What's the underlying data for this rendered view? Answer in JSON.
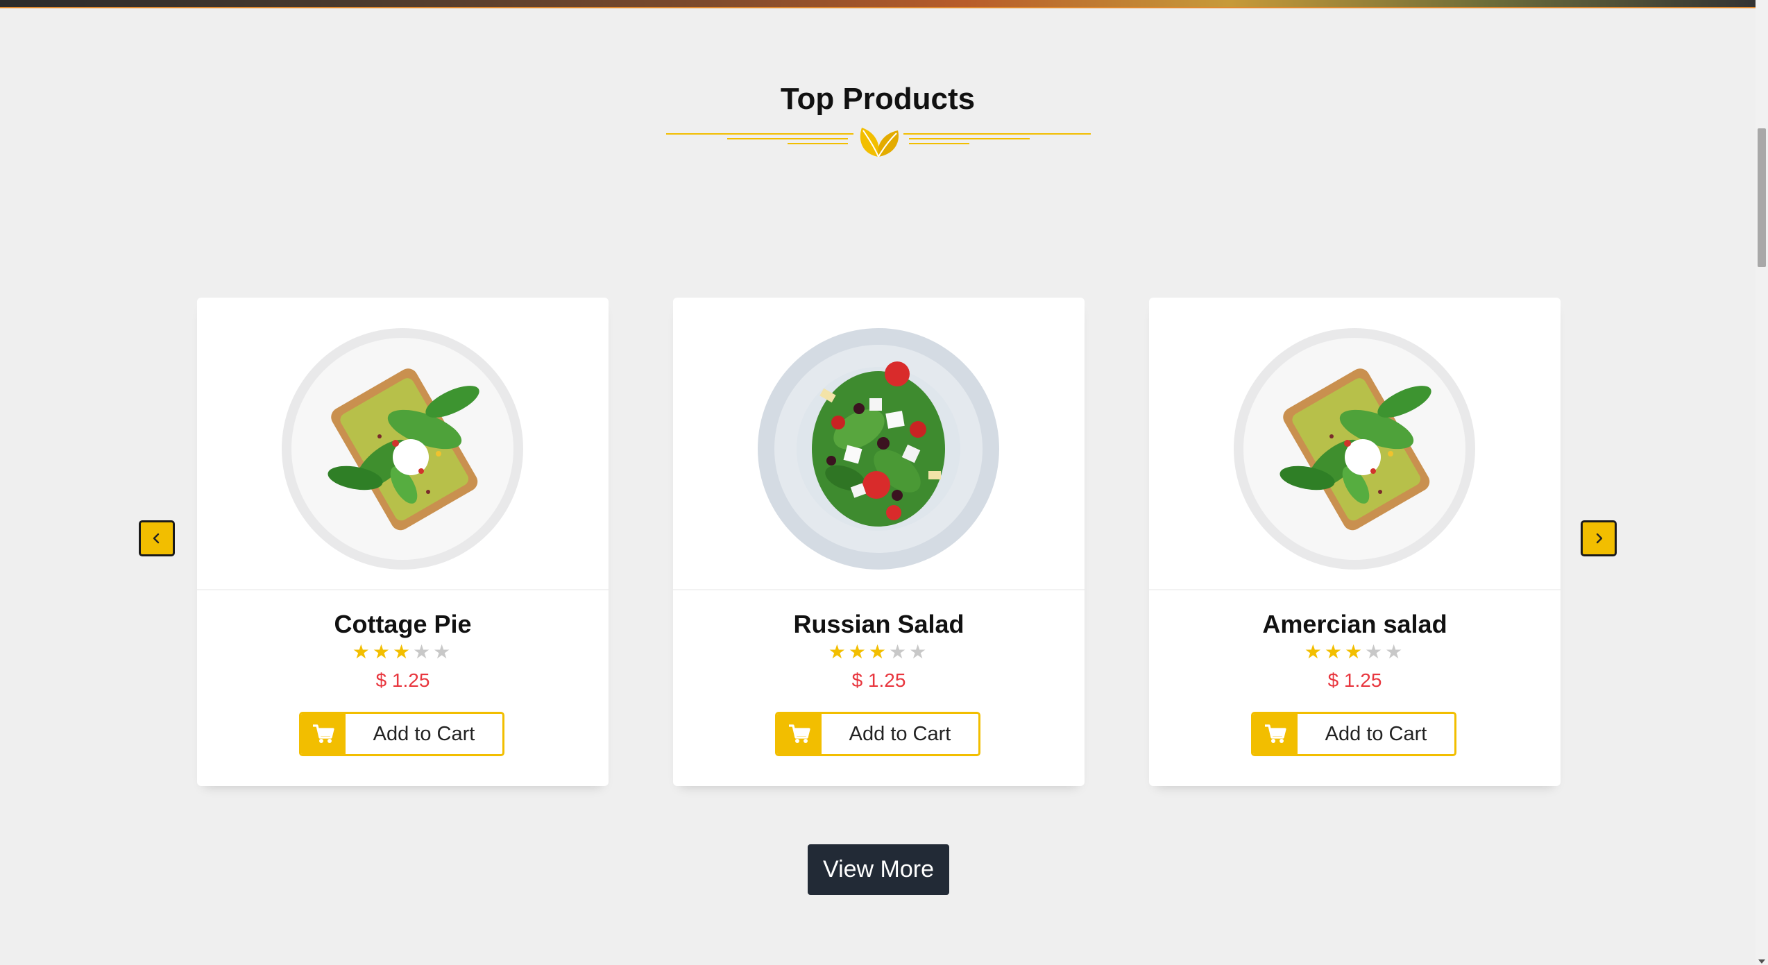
{
  "section": {
    "title": "Top Products"
  },
  "products": [
    {
      "name": "Cottage Pie",
      "rating": 3,
      "max_rating": 5,
      "price": "$ 1.25",
      "button_label": "Add to Cart",
      "image": "toast-salad-plate"
    },
    {
      "name": "Russian Salad",
      "rating": 3,
      "max_rating": 5,
      "price": "$ 1.25",
      "button_label": "Add to Cart",
      "image": "greek-salad-plate"
    },
    {
      "name": "Amercian salad",
      "rating": 3,
      "max_rating": 5,
      "price": "$ 1.25",
      "button_label": "Add to Cart",
      "image": "toast-salad-plate"
    }
  ],
  "carousel": {
    "prev_icon": "chevron-left-icon",
    "next_icon": "chevron-right-icon"
  },
  "footer": {
    "view_more_label": "View More"
  },
  "colors": {
    "accent": "#f2be00",
    "price": "#e8363e",
    "button_dark": "#222a36",
    "background": "#efefef"
  }
}
